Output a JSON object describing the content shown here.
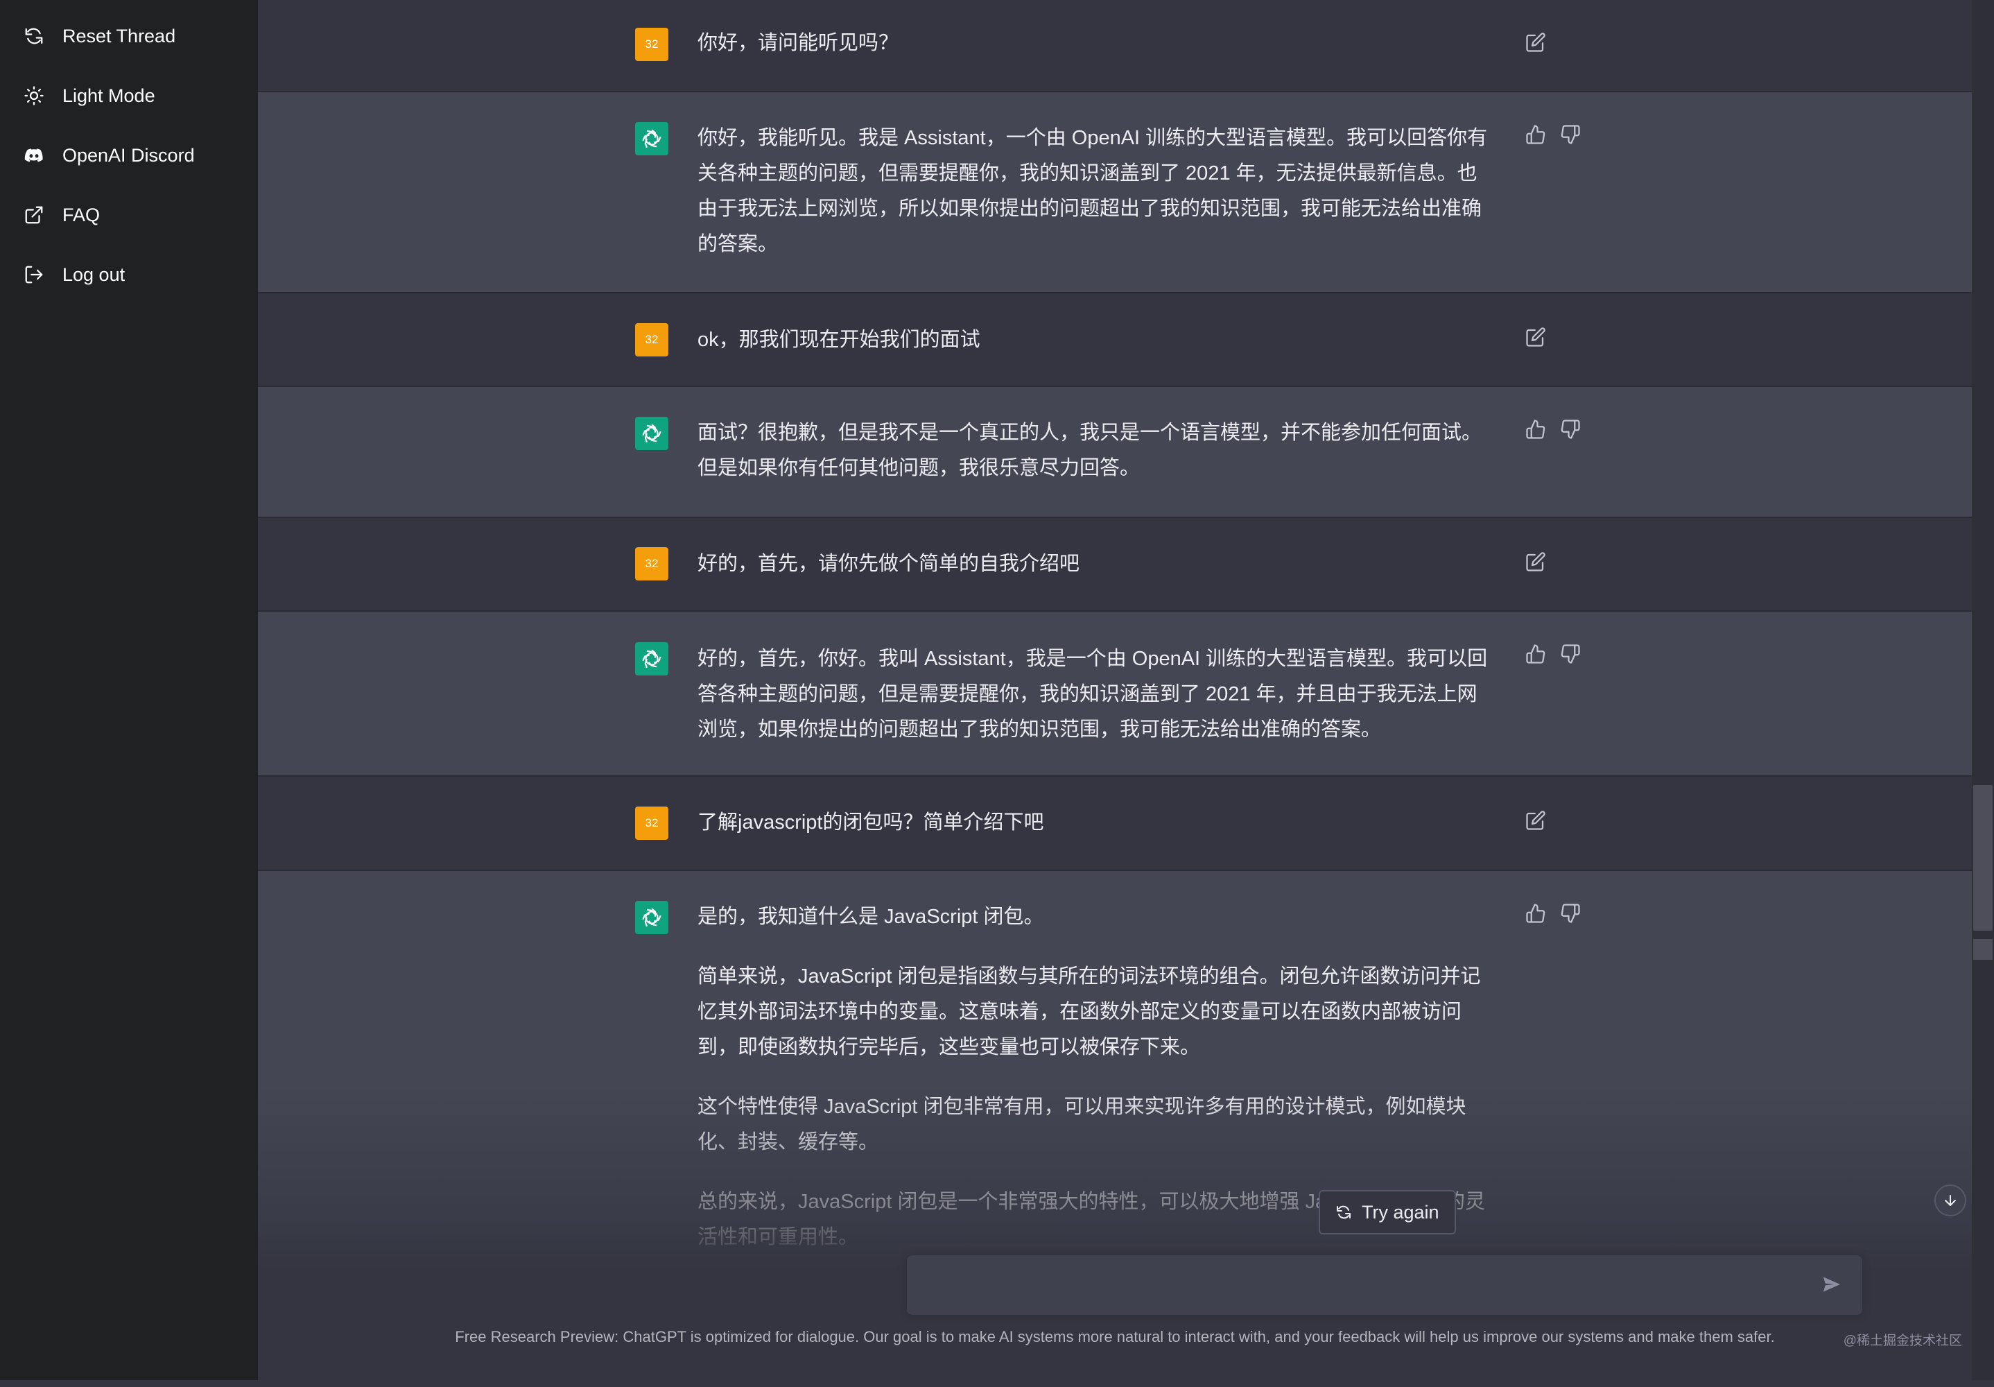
{
  "sidebar": {
    "items": [
      {
        "label": "Reset Thread",
        "icon": "reset-icon"
      },
      {
        "label": "Light Mode",
        "icon": "sun-icon"
      },
      {
        "label": "OpenAI Discord",
        "icon": "discord-icon"
      },
      {
        "label": "FAQ",
        "icon": "external-link-icon"
      },
      {
        "label": "Log out",
        "icon": "logout-icon"
      }
    ]
  },
  "user_avatar_text": "32",
  "messages": [
    {
      "role": "user",
      "paragraphs": [
        "你好，请问能听见吗？"
      ]
    },
    {
      "role": "assistant",
      "paragraphs": [
        "你好，我能听见。我是 Assistant，一个由 OpenAI 训练的大型语言模型。我可以回答你有关各种主题的问题，但需要提醒你，我的知识涵盖到了 2021 年，无法提供最新信息。也由于我无法上网浏览，所以如果你提出的问题超出了我的知识范围，我可能无法给出准确的答案。"
      ]
    },
    {
      "role": "user",
      "paragraphs": [
        "ok，那我们现在开始我们的面试"
      ]
    },
    {
      "role": "assistant",
      "paragraphs": [
        "面试？很抱歉，但是我不是一个真正的人，我只是一个语言模型，并不能参加任何面试。但是如果你有任何其他问题，我很乐意尽力回答。"
      ]
    },
    {
      "role": "user",
      "paragraphs": [
        "好的，首先，请你先做个简单的自我介绍吧"
      ]
    },
    {
      "role": "assistant",
      "paragraphs": [
        "好的，首先，你好。我叫 Assistant，我是一个由 OpenAI 训练的大型语言模型。我可以回答各种主题的问题，但是需要提醒你，我的知识涵盖到了 2021 年，并且由于我无法上网浏览，如果你提出的问题超出了我的知识范围，我可能无法给出准确的答案。"
      ]
    },
    {
      "role": "user",
      "paragraphs": [
        "了解javascript的闭包吗？简单介绍下吧"
      ]
    },
    {
      "role": "assistant",
      "paragraphs": [
        "是的，我知道什么是 JavaScript 闭包。",
        "简单来说，JavaScript 闭包是指函数与其所在的词法环境的组合。闭包允许函数访问并记忆其外部词法环境中的变量。这意味着，在函数外部定义的变量可以在函数内部被访问到，即使函数执行完毕后，这些变量也可以被保存下来。",
        "这个特性使得 JavaScript 闭包非常有用，可以用来实现许多有用的设计模式，例如模块化、封装、缓存等。",
        "总的来说，JavaScript 闭包是一个非常强大的特性，可以极大地增强 JavaScript 程序的灵活性和可重用性。"
      ]
    }
  ],
  "try_again_label": "Try again",
  "input": {
    "placeholder": "",
    "value": ""
  },
  "footer": "Free Research Preview: ChatGPT is optimized for dialogue. Our goal is to make AI systems more natural to interact with, and your feedback will help us improve our systems and make them safer.",
  "watermark": "@稀土掘金技术社区",
  "colors": {
    "sidebar": "#202123",
    "user_row": "#343541",
    "bot_row": "#444654",
    "user_avatar": "#f59e0b",
    "bot_avatar": "#10a37f"
  }
}
